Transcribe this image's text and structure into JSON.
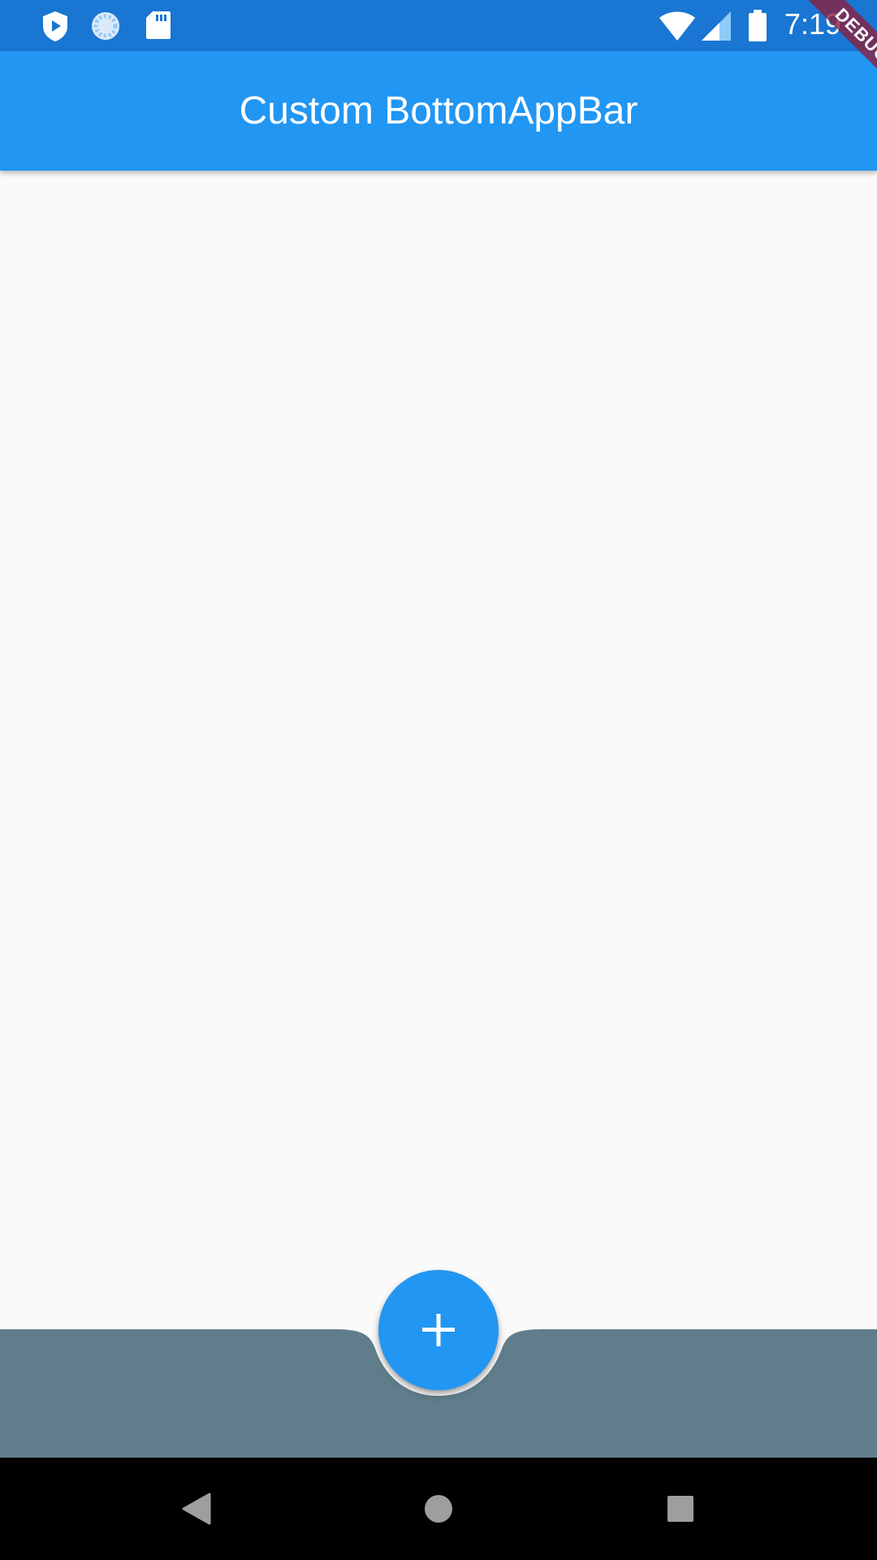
{
  "status_bar": {
    "time": "7:19",
    "icons": [
      "shield-play-icon",
      "loading-spinner-icon",
      "sd-card-icon",
      "wifi-icon",
      "cell-signal-icon",
      "battery-icon"
    ]
  },
  "app_bar": {
    "title": "Custom BottomAppBar"
  },
  "debug_banner": {
    "label": "DEBUG"
  },
  "fab": {
    "icon": "plus-icon"
  },
  "nav_bar": {
    "buttons": [
      "back-icon",
      "home-icon",
      "recents-icon"
    ]
  },
  "colors": {
    "status_bar": "#1976d2",
    "app_bar": "#2196f3",
    "background": "#fafafa",
    "bottom_app_bar": "#607d8b",
    "fab": "#2196f3",
    "nav_bar": "#000000"
  }
}
